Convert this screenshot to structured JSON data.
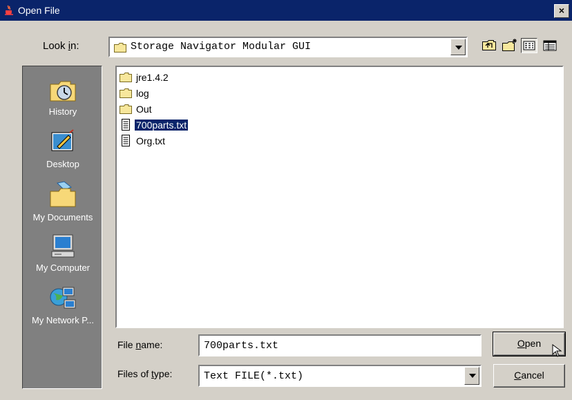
{
  "window": {
    "title": "Open File",
    "close_label": "×",
    "title_icon": "java-cup-icon"
  },
  "lookin": {
    "label_pre": "Look ",
    "label_key": "i",
    "label_post": "n:",
    "value": "Storage Navigator Modular GUI"
  },
  "toolbar": [
    {
      "name": "up-one-level-icon"
    },
    {
      "name": "new-folder-icon"
    },
    {
      "name": "list-view-icon"
    },
    {
      "name": "details-view-icon"
    }
  ],
  "places": [
    {
      "label": "History",
      "icon": "history-icon"
    },
    {
      "label": "Desktop",
      "icon": "desktop-icon"
    },
    {
      "label": "My Documents",
      "icon": "my-documents-icon"
    },
    {
      "label": "My Computer",
      "icon": "my-computer-icon"
    },
    {
      "label": "My Network P...",
      "icon": "my-network-places-icon"
    }
  ],
  "files": [
    {
      "name": "jre1.4.2",
      "type": "folder"
    },
    {
      "name": "log",
      "type": "folder"
    },
    {
      "name": "Out",
      "type": "folder"
    },
    {
      "name": "700parts.txt",
      "type": "text",
      "selected": true
    },
    {
      "name": "Org.txt",
      "type": "text"
    }
  ],
  "filename": {
    "label_pre": "File ",
    "label_key": "n",
    "label_post": "ame:",
    "value": "700parts.txt"
  },
  "filetype": {
    "label_pre": "Files of ",
    "label_key": "t",
    "label_post": "ype:",
    "value": "Text FILE(*.txt)"
  },
  "buttons": {
    "open_key": "O",
    "open_rest": "pen",
    "cancel_key": "C",
    "cancel_rest": "ancel"
  }
}
